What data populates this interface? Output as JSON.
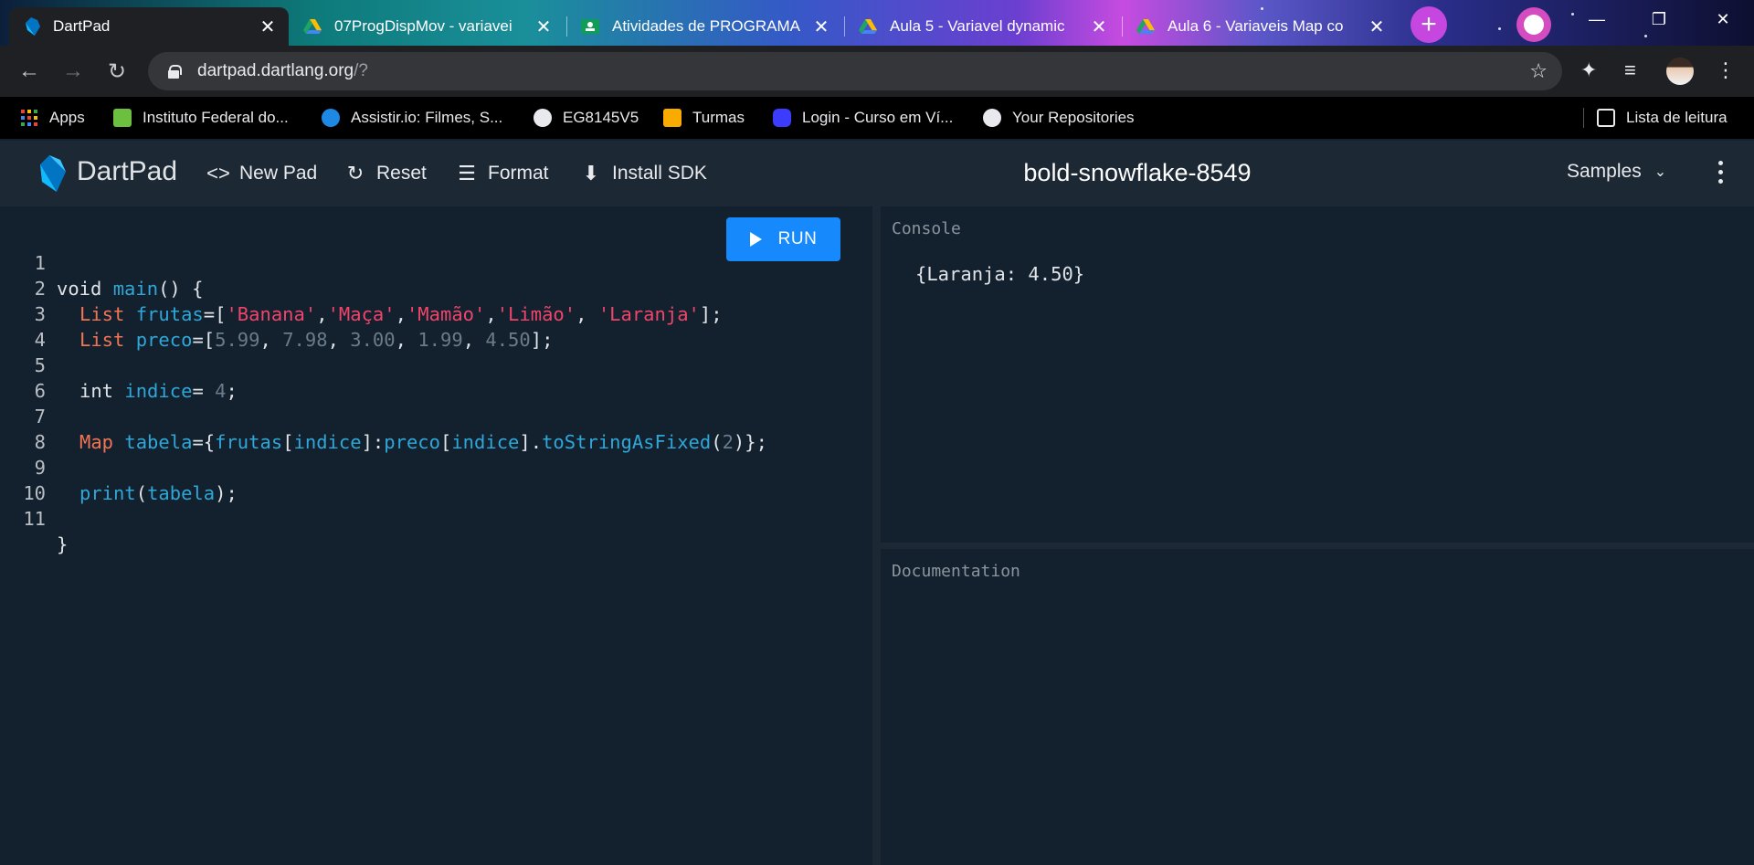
{
  "browser": {
    "tabs": [
      {
        "title": "DartPad",
        "active": true,
        "icon": "dart-icon"
      },
      {
        "title": "07ProgDispMov - variavei",
        "active": false,
        "icon": "google-drive-icon"
      },
      {
        "title": "Atividades de PROGRAMA",
        "active": false,
        "icon": "google-classroom-icon"
      },
      {
        "title": "Aula 5 - Variavel dynamic",
        "active": false,
        "icon": "google-drive-icon"
      },
      {
        "title": "Aula 6 - Variaveis Map co",
        "active": false,
        "icon": "google-drive-icon"
      }
    ],
    "tab_close_glyph": "✕",
    "new_tab_glyph": "+",
    "window_controls": {
      "minimize": "—",
      "restore": "❐",
      "close": "✕"
    },
    "url_host": "dartpad.dartlang.org",
    "url_path": "/?",
    "bookmarks": [
      {
        "label": "Apps",
        "icon": "apps-grid-icon",
        "color": "#ea4335"
      },
      {
        "label": "Instituto Federal do...",
        "icon": "ifsp-icon",
        "color": "#6cbf3f"
      },
      {
        "label": "Assistir.io: Filmes, S...",
        "icon": "play-icon",
        "color": "#1e88e5"
      },
      {
        "label": "EG8145V5",
        "icon": "globe-icon",
        "color": "#e8eaed"
      },
      {
        "label": "Turmas",
        "icon": "google-classroom-icon",
        "color": "#f9ab00"
      },
      {
        "label": "Login - Curso em Ví...",
        "icon": "youtube-icon",
        "color": "#3c3cff"
      },
      {
        "label": "Your Repositories",
        "icon": "github-icon",
        "color": "#e8eaed"
      }
    ],
    "reading_list": "Lista de leitura"
  },
  "dartpad": {
    "brand": "DartPad",
    "buttons": {
      "new_pad": "New Pad",
      "reset": "Reset",
      "format": "Format",
      "install_sdk": "Install SDK"
    },
    "pad_title": "bold-snowflake-8549",
    "samples": "Samples",
    "run": "RUN",
    "console_label": "Console",
    "console_output": "{Laranja: 4.50}",
    "docs_label": "Documentation",
    "line_numbers": [
      "1",
      "2",
      "3",
      "4",
      "5",
      "6",
      "7",
      "8",
      "9",
      "10",
      "11"
    ],
    "code": {
      "l1": {
        "a": "void ",
        "b": "main",
        "c": "() {"
      },
      "l2": {
        "a": "List ",
        "b": "frutas",
        "c": "=[",
        "d": "'Banana'",
        "e": ",",
        "f": "'Maça'",
        "g": ",",
        "h": "'Mamão'",
        "i": ",",
        "j": "'Limão'",
        "k": ", ",
        "l": "'Laranja'",
        "m": "];"
      },
      "l3": {
        "a": "List ",
        "b": "preco",
        "c": "=[",
        "d": "5.99",
        "e": ", ",
        "f": "7.98",
        "g": ", ",
        "h": "3.00",
        "i": ", ",
        "j": "1.99",
        "k": ", ",
        "l": "4.50",
        "m": "];"
      },
      "l5": {
        "a": "int ",
        "b": "indice",
        "c": "= ",
        "d": "4",
        "e": ";"
      },
      "l7": {
        "a": "Map ",
        "b": "tabela",
        "c": "={",
        "d": "frutas",
        "e": "[",
        "f": "indice",
        "g": "]:",
        "h": "preco",
        "i": "[",
        "j": "indice",
        "k": "].",
        "l": "toStringAsFixed",
        "m": "(",
        "n": "2",
        "o": ")};"
      },
      "l9": {
        "a": "print",
        "b": "(",
        "c": "tabela",
        "d": ");"
      },
      "l11": {
        "a": "}"
      }
    }
  }
}
